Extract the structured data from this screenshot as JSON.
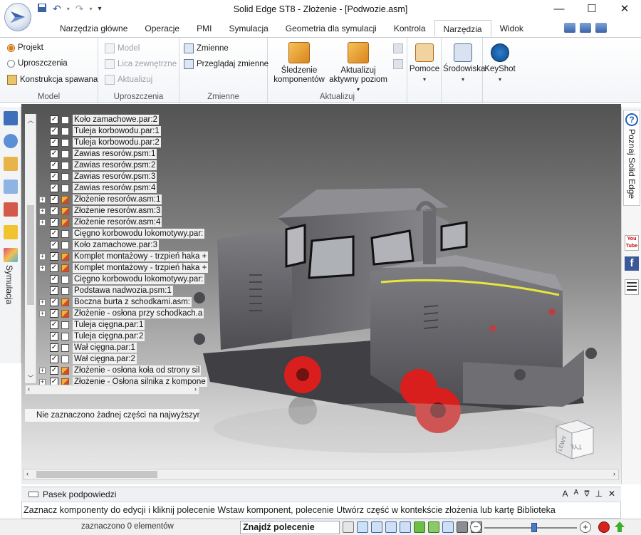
{
  "window": {
    "title": "Solid Edge ST8 - Złożenie - [Podwozie.asm]",
    "controls": [
      "—",
      "☐",
      "✕"
    ]
  },
  "tabs": [
    "Narzędzia główne",
    "Operacje",
    "PMI",
    "Symulacja",
    "Geometria dla symulacji",
    "Kontrola",
    "Narzędzia",
    "Widok"
  ],
  "ribbon": {
    "model": {
      "label": "Model",
      "items": [
        "Projekt",
        "Uproszczenia",
        "Konstrukcja spawana"
      ]
    },
    "uproszczenia": {
      "label": "Uproszczenia",
      "items": [
        "Model",
        "Lica zewnętrzne",
        "Aktualizuj"
      ]
    },
    "zmienne": {
      "label": "Zmienne",
      "items": [
        "Zmienne",
        "Przeglądaj zmienne"
      ]
    },
    "aktualizuj": {
      "label": "Aktualizuj",
      "sledzenie": [
        "Śledzenie",
        "komponentów"
      ],
      "aktywny": [
        "Aktualizuj",
        "aktywny poziom"
      ]
    },
    "pomoce": "Pomoce",
    "srodowiska": "Środowiska",
    "keyshot": "KeyShot"
  },
  "left_strip": {
    "vertical_tab": "Symulacja"
  },
  "pathfinder": {
    "rows": [
      {
        "label": "Koło zamachowe.par:2",
        "type": "part",
        "expand": false
      },
      {
        "label": "Tuleja korbowodu.par:1",
        "type": "part",
        "expand": false
      },
      {
        "label": "Tuleja korbowodu.par:2",
        "type": "part",
        "expand": false
      },
      {
        "label": "Zawias resorów.psm:1",
        "type": "sheet",
        "expand": false
      },
      {
        "label": "Zawias resorów.psm:2",
        "type": "sheet",
        "expand": false
      },
      {
        "label": "Zawias resorów.psm:3",
        "type": "sheet",
        "expand": false
      },
      {
        "label": "Zawias resorów.psm:4",
        "type": "sheet",
        "expand": false
      },
      {
        "label": "Złożenie resorów.asm:1",
        "type": "asm",
        "expand": true
      },
      {
        "label": "Złożenie resorów.asm:3",
        "type": "asm",
        "expand": true
      },
      {
        "label": "Złożenie resorów.asm:4",
        "type": "asm",
        "expand": true
      },
      {
        "label": "Cięgno korbowodu lokomotywy.par:",
        "type": "part",
        "expand": false
      },
      {
        "label": "Koło zamachowe.par:3",
        "type": "part",
        "expand": false
      },
      {
        "label": "Komplet montażowy - trzpień haka +",
        "type": "asm",
        "expand": true
      },
      {
        "label": "Komplet montażowy - trzpień haka +",
        "type": "asm",
        "expand": true
      },
      {
        "label": "Cięgno korbowodu lokomotywy.par:",
        "type": "part",
        "expand": false
      },
      {
        "label": "Podstawa nadwozia.psm:1",
        "type": "sheet",
        "expand": false
      },
      {
        "label": "Boczna burta z schodkami.asm:",
        "type": "asm",
        "expand": true
      },
      {
        "label": "Złożenie - osłona przy schodkach.a",
        "type": "asm",
        "expand": true
      },
      {
        "label": "Tuleja cięgna.par:1",
        "type": "part",
        "expand": false
      },
      {
        "label": "Tuleja cięgna.par:2",
        "type": "part",
        "expand": false
      },
      {
        "label": "Wał cięgna.par:1",
        "type": "part",
        "expand": false
      },
      {
        "label": "Wał cięgna.par:2",
        "type": "part",
        "expand": false
      },
      {
        "label": "Złożenie - osłona koła od strony sil",
        "type": "asm",
        "expand": true
      },
      {
        "label": "Złożenie - Osłona silnika z kompone",
        "type": "asm",
        "expand": true
      }
    ],
    "status": "Nie zaznaczono żadnej części na najwyższym po"
  },
  "view_cube": {
    "face1": "LEWY",
    "face2": "TYŁ"
  },
  "right_strip": {
    "tab": "Poznaj Solid Edge",
    "youtube": "You Tube",
    "facebook": "f"
  },
  "hint_panel": {
    "title": "Pasek podpowiedzi",
    "text": "Zaznacz komponenty do edycji i kliknij polecenie Wstaw komponent, polecenie Utwórz część w kontekście złożenia lub kartę Biblioteka"
  },
  "status_bar": {
    "selection": "zaznaczono 0 elementów",
    "find": "Znajdź polecenie"
  },
  "colors": {
    "accent": "#2b579a",
    "wheel_red": "#d91e1e",
    "highlight_yellow": "#e8e63a"
  }
}
